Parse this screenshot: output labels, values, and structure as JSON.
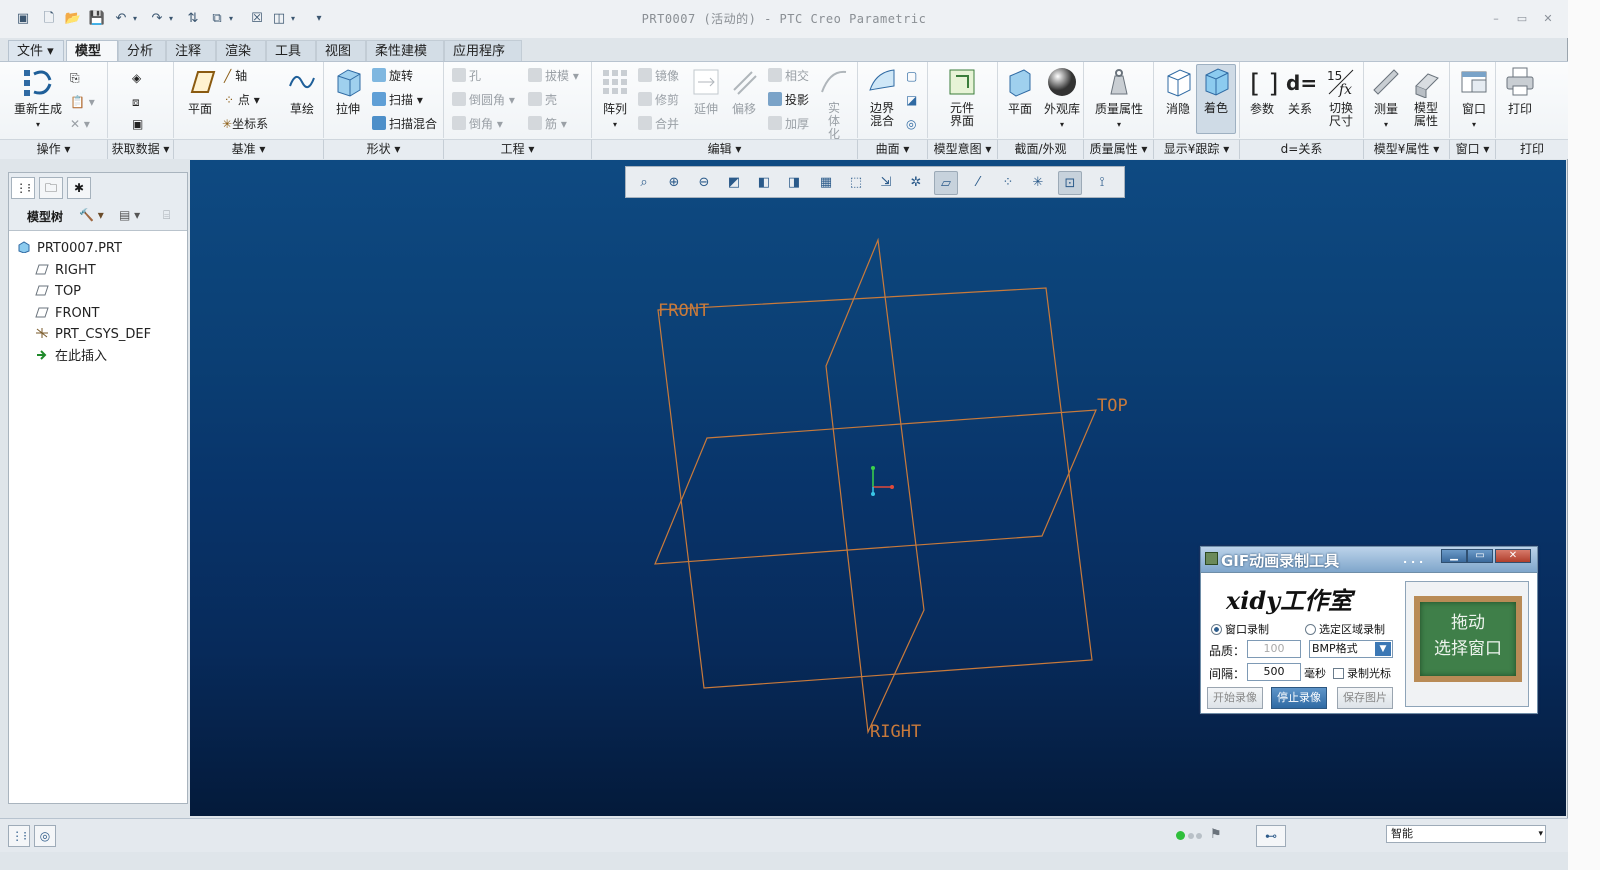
{
  "window": {
    "title": "PRT0007 (活动的) - PTC Creo Parametric"
  },
  "tabs": {
    "file": "文件",
    "model": "模型",
    "analysis": "分析",
    "annotate": "注释",
    "render": "渲染",
    "tools": "工具",
    "view": "视图",
    "flexible": "柔性建模",
    "apps": "应用程序"
  },
  "ribbon": {
    "operations": {
      "regenerate": "重新生成",
      "label": "操作"
    },
    "get_data": {
      "label": "获取数据"
    },
    "datum": {
      "plane": "平面",
      "axis": "轴",
      "point": "点",
      "csys": "坐标系",
      "sketch": "草绘",
      "label": "基准"
    },
    "shapes": {
      "extrude": "拉伸",
      "revolve": "旋转",
      "sweep": "扫描",
      "swept_blend": "扫描混合",
      "label": "形状"
    },
    "engineering": {
      "hole": "孔",
      "round": "倒圆角",
      "chamfer": "倒角",
      "draft": "拔模",
      "shell": "壳",
      "rib": "筋",
      "label": "工程"
    },
    "editing": {
      "pattern": "阵列",
      "mirror": "镜像",
      "trim": "修剪",
      "merge": "合并",
      "extend": "延伸",
      "offset": "偏移",
      "intersect": "相交",
      "project": "投影",
      "thicken": "加厚",
      "solidify": "实体化",
      "label": "编辑"
    },
    "surfaces": {
      "boundary_blend": "边界混合",
      "label": "曲面"
    },
    "model_intent": {
      "component_interface": "元件界面",
      "label": "模型意图"
    },
    "section_appearance": {
      "plane": "平面",
      "appearance_gallery": "外观库",
      "label": "截面/外观"
    },
    "mass_props": {
      "mass_properties": "质量属性",
      "label": "质量属性"
    },
    "display": {
      "hidden_line": "消隐",
      "shading": "着色",
      "label": "显示¥跟踪"
    },
    "relations": {
      "parameters": "参数",
      "relations": "关系",
      "toggle_dim": "切换尺寸",
      "label": "d=关系"
    },
    "model_props": {
      "measure": "测量",
      "model_properties": "模型属性",
      "label": "模型¥属性"
    },
    "window_grp": {
      "window": "窗口",
      "label": "窗口"
    },
    "print_grp": {
      "print": "打印",
      "label": "打印"
    }
  },
  "model_tree": {
    "label": "模型树",
    "items": [
      {
        "name": "PRT0007.PRT",
        "icon": "part-icon"
      },
      {
        "name": "RIGHT",
        "icon": "datum-plane-icon"
      },
      {
        "name": "TOP",
        "icon": "datum-plane-icon"
      },
      {
        "name": "FRONT",
        "icon": "datum-plane-icon"
      },
      {
        "name": "PRT_CSYS_DEF",
        "icon": "csys-icon"
      },
      {
        "name": "在此插入",
        "icon": "insert-here-arrow-icon"
      }
    ]
  },
  "viewport": {
    "plane_labels": {
      "front": "FRONT",
      "top": "TOP",
      "right": "RIGHT"
    }
  },
  "gif_tool": {
    "title": "GIF动画录制工具",
    "dots": ". . .",
    "studio": "xidy工作室",
    "mode_window": "窗口录制",
    "mode_region": "选定区域录制",
    "quality_label": "品质：",
    "quality_value": "100",
    "format_value": "BMP格式",
    "interval_label": "间隔：",
    "interval_value": "500",
    "ms_label": "毫秒",
    "record_cursor": "录制光标",
    "start_btn": "开始录像",
    "stop_btn": "停止录像",
    "save_btn": "保存图片",
    "drag_line1": "拖动",
    "drag_line2": "选择窗口"
  },
  "status": {
    "filter_value": "智能"
  }
}
